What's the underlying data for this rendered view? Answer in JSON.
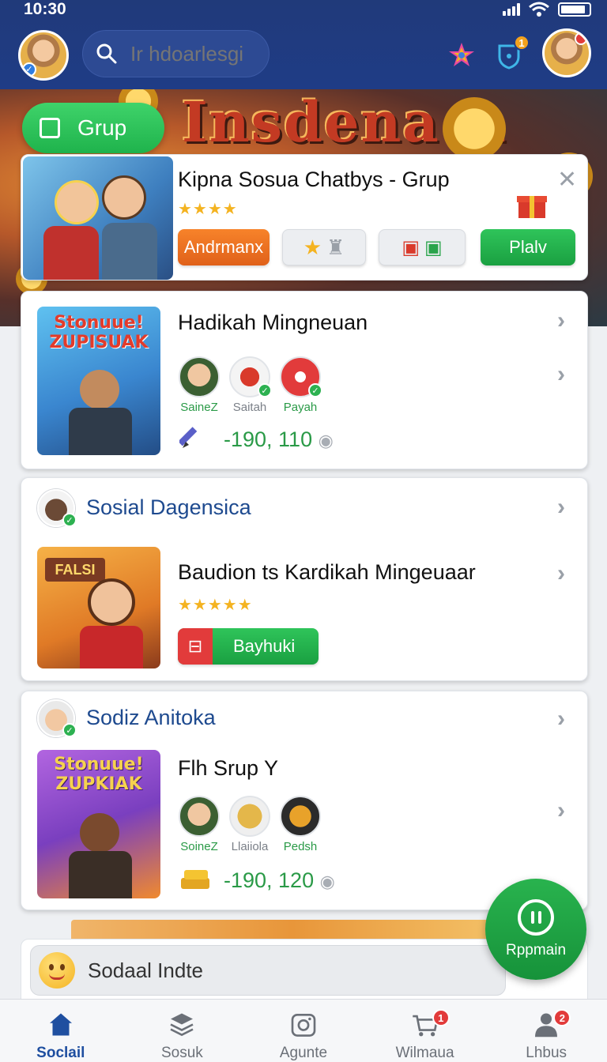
{
  "status_bar": {
    "time": "10:30"
  },
  "header": {
    "search_placeholder": "Ir hdoarlesgi",
    "notification_count": "1"
  },
  "hero": {
    "title": "Insdena A"
  },
  "group_pill": {
    "label": "Grup"
  },
  "featured": {
    "title": "Kipna Sosua Chatbys - Grup",
    "rating_stars": 4,
    "btn_primary": "Andrmanx",
    "btn_play": "Plalv"
  },
  "card1": {
    "title": "Hadikah Mingneuan",
    "thumb_text": "Stonuue! ZUPISUAK",
    "members": [
      {
        "name": "SaineZ"
      },
      {
        "name": "Saitah"
      },
      {
        "name": "Payah"
      }
    ],
    "score": "-190, 110"
  },
  "section2": {
    "title": "Sosial Dagensica",
    "card_title": "Baudion ts Kardikah Mingeuaar",
    "thumb_text": "FALSI",
    "rating_stars": 5,
    "button": "Bayhuki"
  },
  "section3": {
    "title": "Sodiz Anitoka",
    "card_title": "Flh Srup Y",
    "thumb_text": "Stonuue! ZUPKIAK",
    "members": [
      {
        "name": "SoineZ"
      },
      {
        "name": "Llaiiola"
      },
      {
        "name": "Pedsh"
      }
    ],
    "score": "-190, 120"
  },
  "fab": {
    "label": "Rppmain"
  },
  "social_indicator": {
    "label": "Sodaal Indte"
  },
  "bottom_nav": [
    {
      "label": "Soclail",
      "icon": "home-icon",
      "active": true
    },
    {
      "label": "Sosuk",
      "icon": "layers-icon"
    },
    {
      "label": "Agunte",
      "icon": "camera-icon"
    },
    {
      "label": "Wilmaua",
      "icon": "cart-icon",
      "badge": "1"
    },
    {
      "label": "Lhbus",
      "icon": "person-icon",
      "badge": "2"
    }
  ],
  "colors": {
    "header_bg": "#1f3c86",
    "accent_green": "#1fb34c",
    "accent_orange": "#f7832a",
    "section_title": "#1e4a8f",
    "badge_red": "#e23b3b"
  }
}
